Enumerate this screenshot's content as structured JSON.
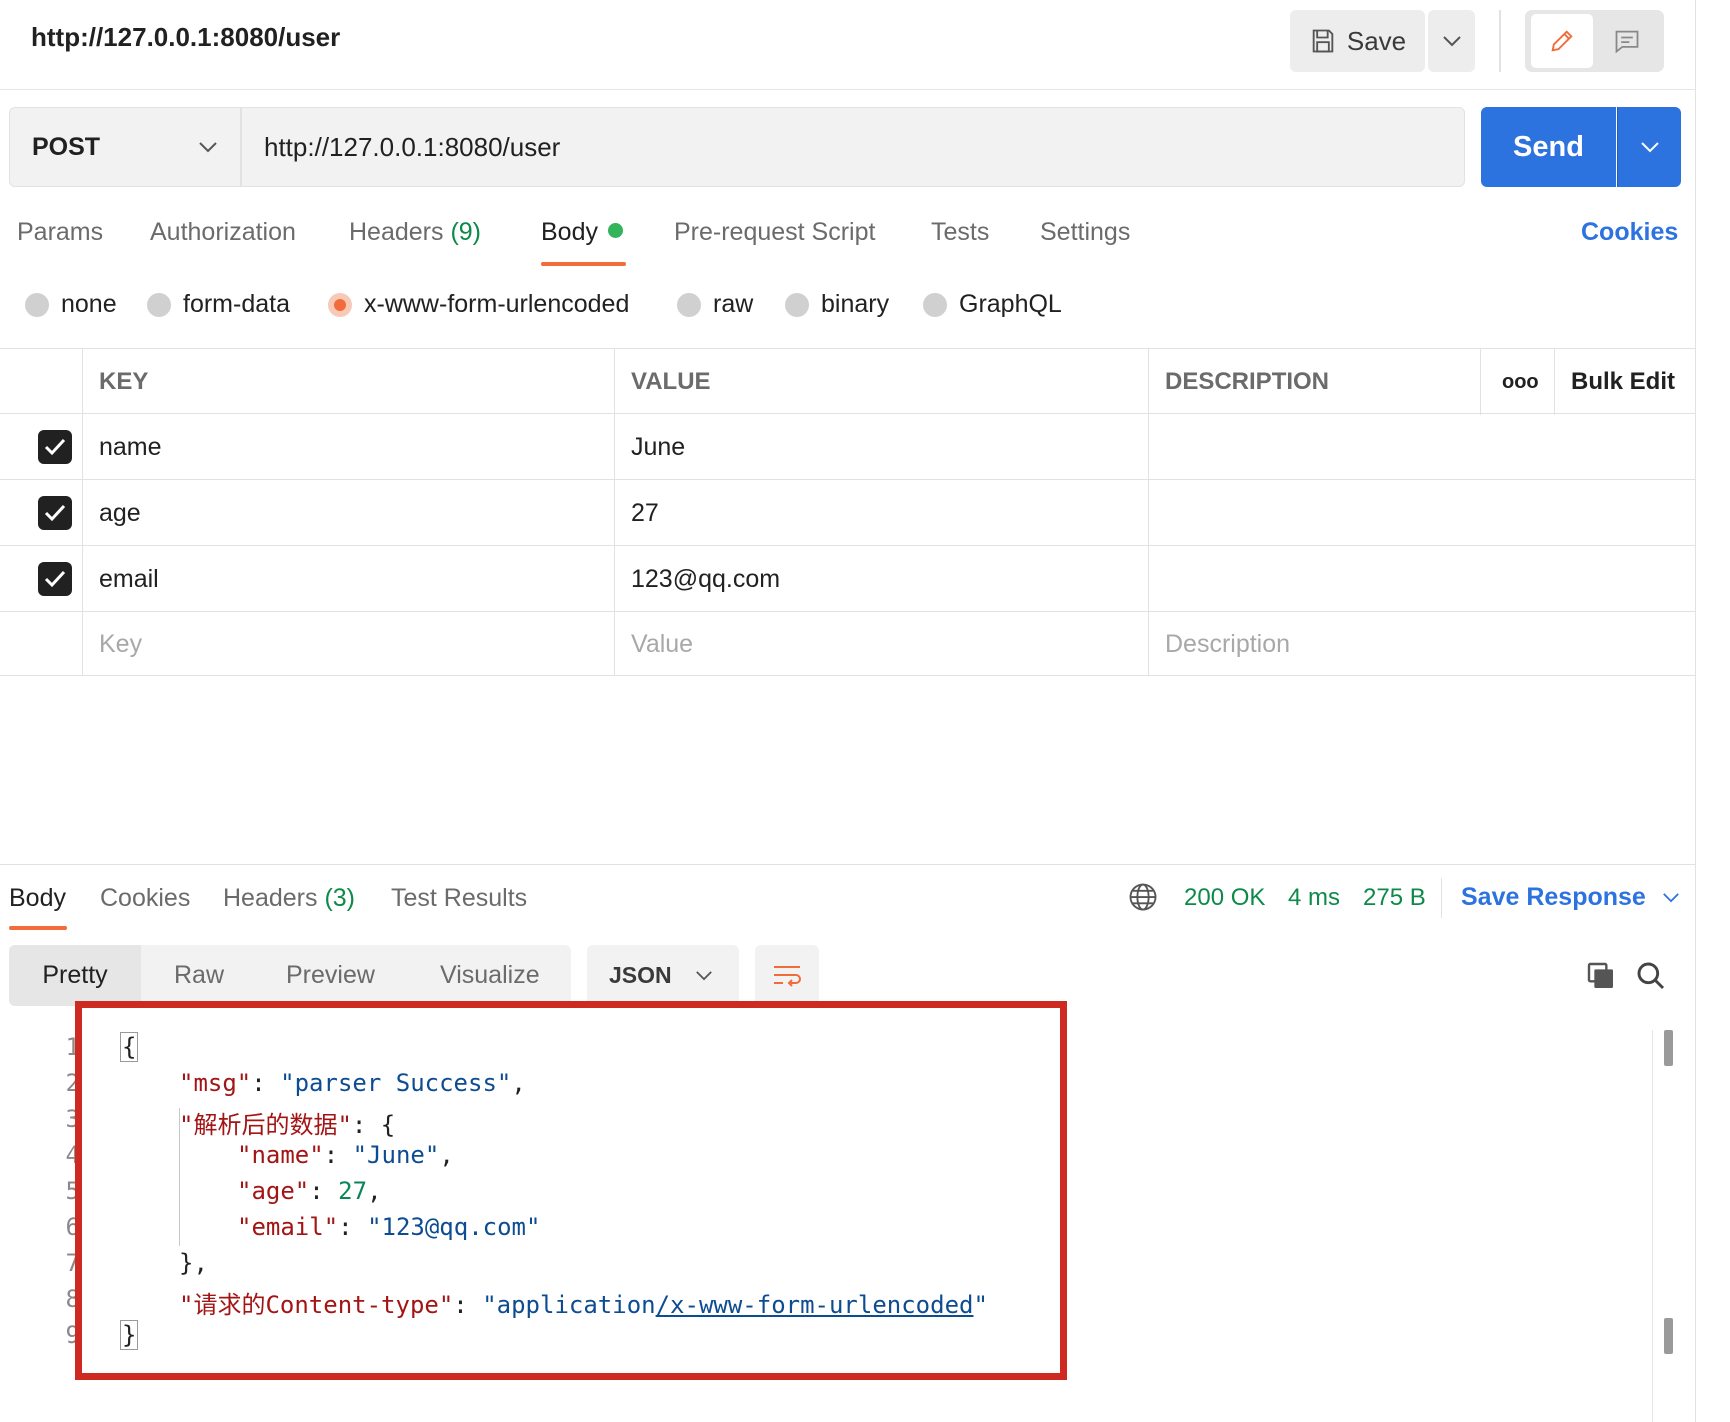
{
  "request": {
    "title": "http://127.0.0.1:8080/user",
    "save_label": "Save",
    "method": "POST",
    "url": "http://127.0.0.1:8080/user",
    "send_label": "Send"
  },
  "request_tabs": {
    "params": "Params",
    "authorization": "Authorization",
    "headers": "Headers",
    "headers_count": "(9)",
    "body": "Body",
    "prerequest": "Pre-request Script",
    "tests": "Tests",
    "settings": "Settings",
    "cookies": "Cookies"
  },
  "body_types": {
    "selected": "x-www-form-urlencoded",
    "options": [
      "none",
      "form-data",
      "x-www-form-urlencoded",
      "raw",
      "binary",
      "GraphQL"
    ]
  },
  "params_table": {
    "columns": {
      "key": "KEY",
      "value": "VALUE",
      "description": "DESCRIPTION",
      "more": "ooo",
      "bulk_edit": "Bulk Edit"
    },
    "rows": [
      {
        "key": "name",
        "value": "June",
        "description": "",
        "checked": true
      },
      {
        "key": "age",
        "value": "27",
        "description": "",
        "checked": true
      },
      {
        "key": "email",
        "value": "123@qq.com",
        "description": "",
        "checked": true
      }
    ],
    "placeholders": {
      "key": "Key",
      "value": "Value",
      "description": "Description"
    }
  },
  "response_tabs": {
    "body": "Body",
    "cookies": "Cookies",
    "headers": "Headers",
    "headers_count": "(3)",
    "test_results": "Test Results"
  },
  "response_status": {
    "status": "200 OK",
    "time": "4 ms",
    "size": "275 B",
    "save_response": "Save Response"
  },
  "response_view": {
    "formats": [
      "Pretty",
      "Raw",
      "Preview",
      "Visualize"
    ],
    "selected_format": "Pretty",
    "language": "JSON"
  },
  "response_code": {
    "line_numbers": [
      "1",
      "2",
      "3",
      "4",
      "5",
      "6",
      "7",
      "8",
      "9"
    ],
    "open_brace": "{",
    "close_brace": "}",
    "inner_close": "},",
    "msg_key": "\"msg\"",
    "msg_value": "\"parser Success\"",
    "parsed_key": "\"解析后的数据\"",
    "name_key": "\"name\"",
    "name_value": "\"June\"",
    "age_key": "\"age\"",
    "age_value": "27",
    "email_key": "\"email\"",
    "email_value": "\"123@qq.com\"",
    "ctype_key": "\"请求的Content-type\"",
    "ctype_value_prefix": "\"application",
    "ctype_value_link": "/x-www-form-urlencoded",
    "ctype_value_suffix": "\""
  },
  "colors": {
    "accent_orange": "#f26b3a",
    "send_blue": "#2d73e0",
    "status_green": "#0d8a4a",
    "highlight_red": "#cf2a21"
  }
}
